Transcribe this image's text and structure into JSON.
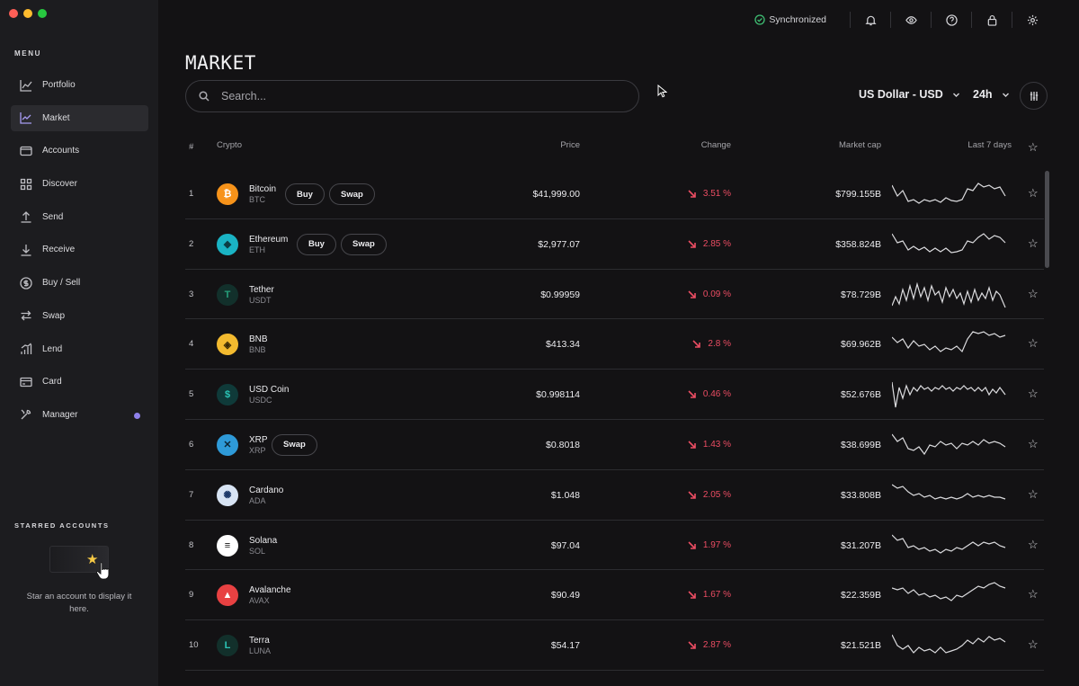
{
  "window": {
    "traffic_colors": [
      "#ff5f57",
      "#febc2e",
      "#28c840"
    ]
  },
  "sidebar": {
    "menu_title": "MENU",
    "items": [
      {
        "label": "Portfolio",
        "icon": "portfolio-chart-icon",
        "active": false
      },
      {
        "label": "Market",
        "icon": "market-chart-icon",
        "active": true
      },
      {
        "label": "Accounts",
        "icon": "wallet-icon",
        "active": false
      },
      {
        "label": "Discover",
        "icon": "grid-icon",
        "active": false
      },
      {
        "label": "Send",
        "icon": "send-arrow-up-icon",
        "active": false
      },
      {
        "label": "Receive",
        "icon": "receive-arrow-down-icon",
        "active": false
      },
      {
        "label": "Buy / Sell",
        "icon": "dollar-circle-icon",
        "active": false
      },
      {
        "label": "Swap",
        "icon": "swap-arrows-icon",
        "active": false
      },
      {
        "label": "Lend",
        "icon": "lend-bars-icon",
        "active": false
      },
      {
        "label": "Card",
        "icon": "credit-card-icon",
        "active": false
      },
      {
        "label": "Manager",
        "icon": "tools-icon",
        "active": false,
        "badge_dot": true
      }
    ],
    "starred_title": "STARRED ACCOUNTS",
    "starred_empty_message": "Star an account to display it here."
  },
  "topbar": {
    "sync_status": "Synchronized",
    "icons": [
      "bell-icon",
      "eye-icon",
      "help-icon",
      "lock-icon",
      "settings-gear-icon"
    ]
  },
  "main": {
    "title": "MARKET",
    "search_placeholder": "Search...",
    "currency": "US Dollar - USD",
    "period": "24h",
    "columns": {
      "rank": "#",
      "crypto": "Crypto",
      "price": "Price",
      "change": "Change",
      "market_cap": "Market cap",
      "last_7_days": "Last 7 days"
    },
    "rows": [
      {
        "rank": "1",
        "name": "Bitcoin",
        "ticker": "BTC",
        "price": "$41,999.00",
        "change": "3.51 %",
        "market_cap": "$799.155B",
        "actions": [
          "Buy",
          "Swap"
        ],
        "icon_glyph": "₿",
        "icon_bg": "#f7931a",
        "icon_fg": "#ffffff"
      },
      {
        "rank": "2",
        "name": "Ethereum",
        "ticker": "ETH",
        "price": "$2,977.07",
        "change": "2.85 %",
        "market_cap": "$358.824B",
        "actions": [
          "Buy",
          "Swap"
        ],
        "icon_glyph": "◆",
        "icon_bg": "#1ab3c4",
        "icon_fg": "#0c3d44"
      },
      {
        "rank": "3",
        "name": "Tether",
        "ticker": "USDT",
        "price": "$0.99959",
        "change": "0.09 %",
        "market_cap": "$78.729B",
        "actions": [],
        "icon_glyph": "T",
        "icon_bg": "#12302b",
        "icon_fg": "#26a17b"
      },
      {
        "rank": "4",
        "name": "BNB",
        "ticker": "BNB",
        "price": "$413.34",
        "change": "2.8 %",
        "market_cap": "$69.962B",
        "actions": [],
        "icon_glyph": "◈",
        "icon_bg": "#f3ba2f",
        "icon_fg": "#3a2a05"
      },
      {
        "rank": "5",
        "name": "USD Coin",
        "ticker": "USDC",
        "price": "$0.998114",
        "change": "0.46 %",
        "market_cap": "$52.676B",
        "actions": [],
        "icon_glyph": "$",
        "icon_bg": "#0f3a39",
        "icon_fg": "#2bc4b5"
      },
      {
        "rank": "6",
        "name": "XRP",
        "ticker": "XRP",
        "price": "$0.8018",
        "change": "1.43 %",
        "market_cap": "$38.699B",
        "actions": [
          "Swap"
        ],
        "icon_glyph": "✕",
        "icon_bg": "#2e9ad8",
        "icon_fg": "#0b2433"
      },
      {
        "rank": "7",
        "name": "Cardano",
        "ticker": "ADA",
        "price": "$1.048",
        "change": "2.05 %",
        "market_cap": "$33.808B",
        "actions": [],
        "icon_glyph": "✺",
        "icon_bg": "#d8e4f4",
        "icon_fg": "#1e3a6a"
      },
      {
        "rank": "8",
        "name": "Solana",
        "ticker": "SOL",
        "price": "$97.04",
        "change": "1.97 %",
        "market_cap": "$31.207B",
        "actions": [],
        "icon_glyph": "≡",
        "icon_bg": "#ffffff",
        "icon_fg": "#111111"
      },
      {
        "rank": "9",
        "name": "Avalanche",
        "ticker": "AVAX",
        "price": "$90.49",
        "change": "1.67 %",
        "market_cap": "$22.359B",
        "actions": [],
        "icon_glyph": "▲",
        "icon_bg": "#e84142",
        "icon_fg": "#ffffff"
      },
      {
        "rank": "10",
        "name": "Terra",
        "ticker": "LUNA",
        "price": "$54.17",
        "change": "2.87 %",
        "market_cap": "$21.521B",
        "actions": [],
        "icon_glyph": "L",
        "icon_bg": "#12302b",
        "icon_fg": "#2bc4b5"
      }
    ]
  },
  "colors": {
    "negative_change": "#ec4d63",
    "accent": "#8e80ea",
    "synchronized": "#3fbf73"
  }
}
